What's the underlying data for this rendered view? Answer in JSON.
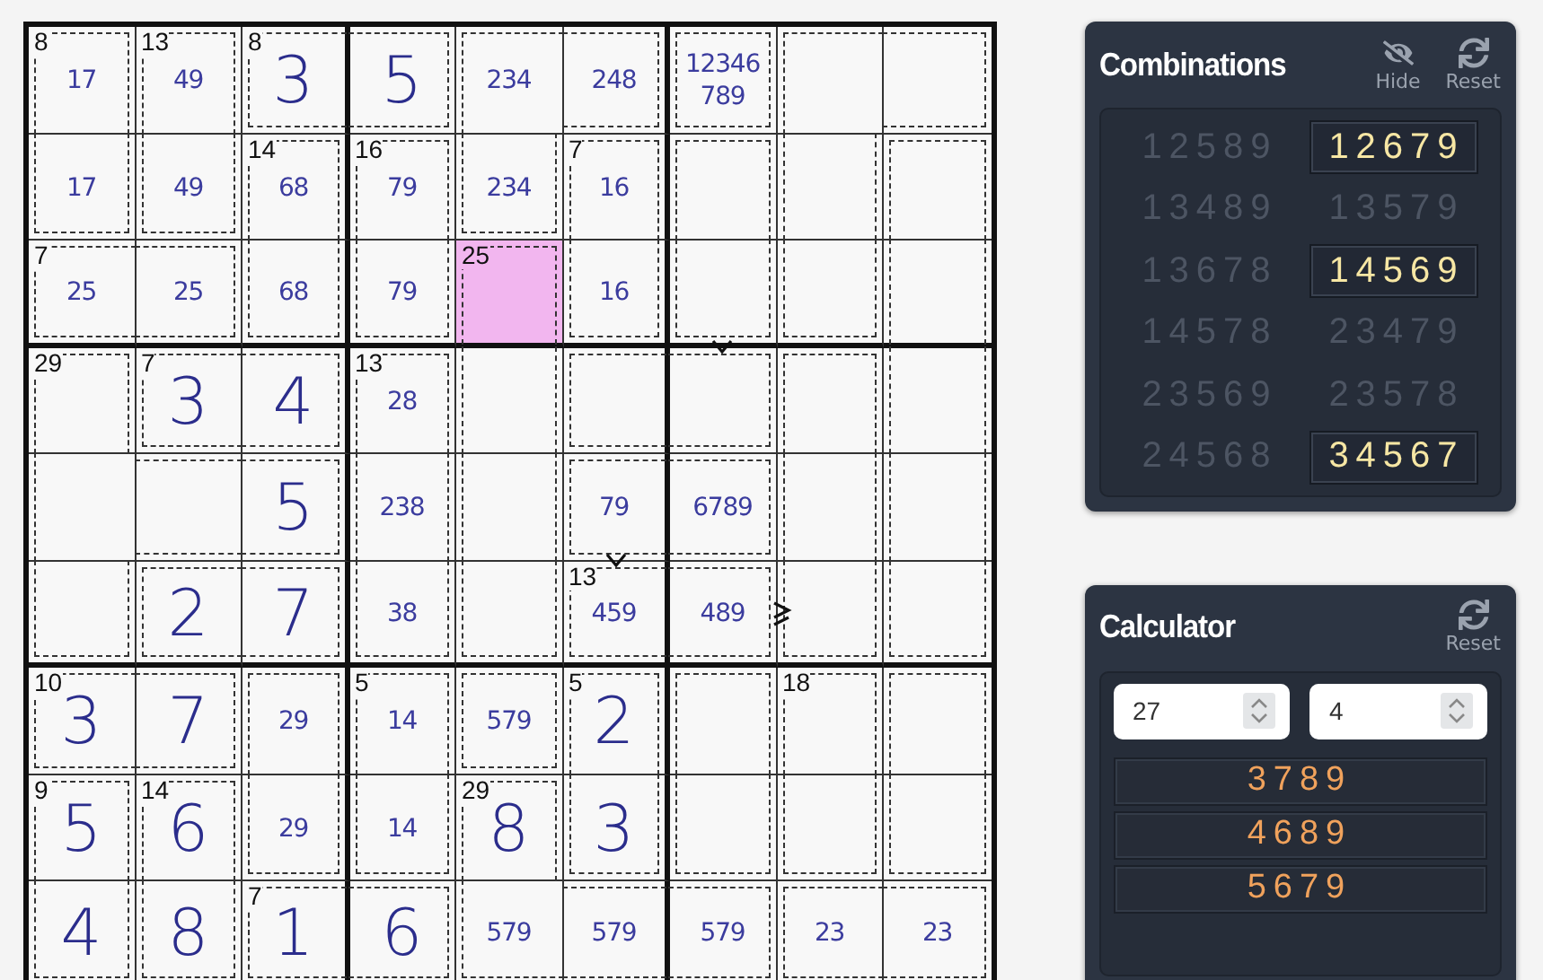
{
  "grid": {
    "rows": [
      [
        {
          "sum": "8",
          "candidates": [
            "17"
          ],
          "join_right": false,
          "join_down": true,
          "selected": false
        },
        {
          "sum": "13",
          "candidates": [
            "49"
          ],
          "join_right": false,
          "join_down": true,
          "selected": false
        },
        {
          "sum": "8",
          "value": "3",
          "join_right": true,
          "join_down": false,
          "selected": false
        },
        {
          "value": "5",
          "join_right": false,
          "join_down": false,
          "selected": false
        },
        {
          "candidates": [
            "234"
          ],
          "join_right": true,
          "join_down": true,
          "selected": false
        },
        {
          "candidates": [
            "248"
          ],
          "join_right": false,
          "join_down": false,
          "selected": false
        },
        {
          "candidates": [
            "12346",
            "789"
          ],
          "join_right": false,
          "join_down": false,
          "selected": false
        },
        {
          "join_right": true,
          "join_down": true,
          "selected": false
        },
        {
          "join_down": false,
          "selected": false
        }
      ],
      [
        {
          "candidates": [
            "17"
          ],
          "join_right": false,
          "join_down": false,
          "selected": false
        },
        {
          "candidates": [
            "49"
          ],
          "join_right": false,
          "join_down": false,
          "selected": false
        },
        {
          "sum": "14",
          "candidates": [
            "68"
          ],
          "join_right": false,
          "join_down": true,
          "selected": false
        },
        {
          "sum": "16",
          "candidates": [
            "79"
          ],
          "join_right": false,
          "join_down": true,
          "selected": false
        },
        {
          "candidates": [
            "234"
          ],
          "join_right": false,
          "join_down": false,
          "selected": false
        },
        {
          "sum": "7",
          "candidates": [
            "16"
          ],
          "join_right": false,
          "join_down": true,
          "selected": false
        },
        {
          "join_right": false,
          "join_down": true,
          "selected": false
        },
        {
          "join_right": false,
          "join_down": true,
          "selected": false
        },
        {
          "join_down": true,
          "selected": false
        }
      ],
      [
        {
          "sum": "7",
          "candidates": [
            "25"
          ],
          "join_right": true,
          "join_down": false,
          "selected": false
        },
        {
          "candidates": [
            "25"
          ],
          "join_right": false,
          "join_down": false,
          "selected": false
        },
        {
          "candidates": [
            "68"
          ],
          "join_right": false,
          "join_down": false,
          "selected": false
        },
        {
          "candidates": [
            "79"
          ],
          "join_right": false,
          "join_down": false,
          "selected": false
        },
        {
          "sum": "25",
          "join_right": false,
          "join_down": true,
          "selected": true
        },
        {
          "candidates": [
            "16"
          ],
          "join_right": false,
          "join_down": false,
          "selected": false
        },
        {
          "mark_below": true,
          "join_right": false,
          "join_down": false,
          "selected": false
        },
        {
          "join_right": false,
          "join_down": false,
          "selected": false
        },
        {
          "join_down": true,
          "selected": false
        }
      ],
      [
        {
          "sum": "29",
          "join_right": false,
          "join_down": true,
          "selected": false
        },
        {
          "sum": "7",
          "value": "3",
          "join_right": true,
          "join_down": false,
          "selected": false
        },
        {
          "value": "4",
          "join_right": false,
          "join_down": false,
          "selected": false
        },
        {
          "sum": "13",
          "candidates": [
            "28"
          ],
          "join_right": false,
          "join_down": true,
          "selected": false
        },
        {
          "join_right": false,
          "join_down": true,
          "selected": false
        },
        {
          "join_right": true,
          "join_down": false,
          "selected": false
        },
        {
          "join_right": false,
          "join_down": false,
          "selected": false
        },
        {
          "join_right": false,
          "join_down": true,
          "selected": false
        },
        {
          "join_down": true,
          "selected": false
        }
      ],
      [
        {
          "join_right": true,
          "join_down": true,
          "selected": false
        },
        {
          "join_right": true,
          "join_down": false,
          "selected": false
        },
        {
          "value": "5",
          "join_right": false,
          "join_down": false,
          "selected": false
        },
        {
          "candidates": [
            "238"
          ],
          "join_right": false,
          "join_down": true,
          "selected": false
        },
        {
          "join_right": false,
          "join_down": true,
          "selected": false
        },
        {
          "candidates": [
            "79"
          ],
          "mark_below": true,
          "join_right": true,
          "join_down": false,
          "selected": false
        },
        {
          "candidates": [
            "6789"
          ],
          "join_right": false,
          "join_down": false,
          "selected": false
        },
        {
          "join_right": false,
          "join_down": true,
          "selected": false
        },
        {
          "join_down": true,
          "selected": false
        }
      ],
      [
        {
          "join_right": false,
          "join_down": false,
          "selected": false
        },
        {
          "value": "2",
          "join_right": true,
          "join_down": false,
          "selected": false
        },
        {
          "value": "7",
          "join_right": false,
          "join_down": false,
          "selected": false
        },
        {
          "candidates": [
            "38"
          ],
          "join_right": false,
          "join_down": false,
          "selected": false
        },
        {
          "join_right": false,
          "join_down": false,
          "selected": false
        },
        {
          "sum": "13",
          "candidates": [
            "459"
          ],
          "join_right": true,
          "join_down": false,
          "selected": false
        },
        {
          "candidates": [
            "489"
          ],
          "mark_right": true,
          "join_right": false,
          "join_down": false,
          "selected": false
        },
        {
          "join_right": false,
          "join_down": false,
          "selected": false
        },
        {
          "join_down": false,
          "selected": false
        }
      ],
      [
        {
          "sum": "10",
          "value": "3",
          "join_right": true,
          "join_down": false,
          "selected": false
        },
        {
          "value": "7",
          "join_right": false,
          "join_down": false,
          "selected": false
        },
        {
          "candidates": [
            "29"
          ],
          "join_right": false,
          "join_down": true,
          "selected": false
        },
        {
          "sum": "5",
          "candidates": [
            "14"
          ],
          "join_right": false,
          "join_down": true,
          "selected": false
        },
        {
          "candidates": [
            "579"
          ],
          "join_right": false,
          "join_down": false,
          "selected": false
        },
        {
          "sum": "5",
          "value": "2",
          "join_right": false,
          "join_down": true,
          "selected": false
        },
        {
          "join_right": false,
          "join_down": true,
          "selected": false
        },
        {
          "sum": "18",
          "join_right": false,
          "join_down": true,
          "selected": false
        },
        {
          "join_down": true,
          "selected": false
        }
      ],
      [
        {
          "sum": "9",
          "value": "5",
          "join_right": false,
          "join_down": true,
          "selected": false
        },
        {
          "sum": "14",
          "value": "6",
          "join_right": false,
          "join_down": true,
          "selected": false
        },
        {
          "candidates": [
            "29"
          ],
          "join_right": false,
          "join_down": false,
          "selected": false
        },
        {
          "candidates": [
            "14"
          ],
          "join_right": false,
          "join_down": false,
          "selected": false
        },
        {
          "sum": "29",
          "value": "8",
          "join_right": false,
          "join_down": true,
          "selected": false
        },
        {
          "value": "3",
          "join_right": false,
          "join_down": false,
          "selected": false
        },
        {
          "join_right": false,
          "join_down": false,
          "selected": false
        },
        {
          "join_right": false,
          "join_down": false,
          "selected": false
        },
        {
          "join_down": false,
          "selected": false
        }
      ],
      [
        {
          "value": "4",
          "join_right": false,
          "selected": false
        },
        {
          "value": "8",
          "join_right": false,
          "selected": false
        },
        {
          "sum": "7",
          "value": "1",
          "join_right": true,
          "selected": false
        },
        {
          "value": "6",
          "join_right": false,
          "selected": false
        },
        {
          "candidates": [
            "579"
          ],
          "join_right": true,
          "selected": false
        },
        {
          "candidates": [
            "579"
          ],
          "join_right": true,
          "selected": false
        },
        {
          "candidates": [
            "579"
          ],
          "join_right": false,
          "selected": false
        },
        {
          "candidates": [
            "23"
          ],
          "join_right": true,
          "selected": false
        },
        {
          "candidates": [
            "23"
          ],
          "selected": false
        }
      ]
    ]
  },
  "combinations": {
    "title": "Combinations",
    "hide_label": "Hide",
    "reset_label": "Reset",
    "items": [
      {
        "text": "12589",
        "selected": false
      },
      {
        "text": "12679",
        "selected": true
      },
      {
        "text": "13489",
        "selected": false
      },
      {
        "text": "13579",
        "selected": false
      },
      {
        "text": "13678",
        "selected": false
      },
      {
        "text": "14569",
        "selected": true
      },
      {
        "text": "14578",
        "selected": false
      },
      {
        "text": "23479",
        "selected": false
      },
      {
        "text": "23569",
        "selected": false
      },
      {
        "text": "23578",
        "selected": false
      },
      {
        "text": "24568",
        "selected": false
      },
      {
        "text": "34567",
        "selected": true
      }
    ]
  },
  "calculator": {
    "title": "Calculator",
    "reset_label": "Reset",
    "sum": "27",
    "count": "4",
    "results": [
      "3789",
      "4689",
      "5679"
    ]
  }
}
